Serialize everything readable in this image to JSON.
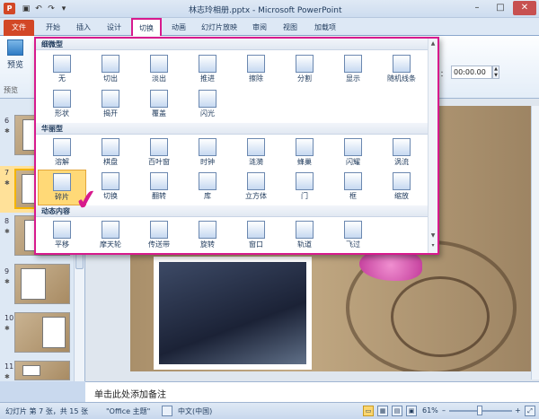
{
  "window": {
    "title": "林志玲相册.pptx - Microsoft PowerPoint",
    "app_icon": "P",
    "minimize_glyph": "–",
    "maximize_glyph": "□",
    "close_glyph": "✕"
  },
  "qat": {
    "save_icon": "▣",
    "undo_icon": "↶",
    "redo_icon": "↷",
    "menu_icon": "▾"
  },
  "tabs": {
    "file": "文件",
    "items": [
      "开始",
      "插入",
      "设计",
      "切换",
      "动画",
      "幻灯片放映",
      "审阅",
      "视图",
      "加载项"
    ],
    "active": "切换"
  },
  "ribbon": {
    "preview_label": "预览",
    "group_preview": "预览",
    "time_label": "：",
    "time_value": "00:00.00",
    "spin_up": "▲",
    "spin_down": "▼"
  },
  "gallery": {
    "sections": [
      {
        "title": "细微型",
        "items": [
          "无",
          "切出",
          "淡出",
          "推进",
          "擦除",
          "分割",
          "显示",
          "随机线条",
          "形状",
          "揭开",
          "覆盖",
          "闪光"
        ]
      },
      {
        "title": "华丽型",
        "items": [
          "溶解",
          "棋盘",
          "百叶窗",
          "时钟",
          "涟漪",
          "蜂巢",
          "闪耀",
          "涡流",
          "碎片",
          "切换",
          "翻转",
          "库",
          "立方体",
          "门",
          "框",
          "缩放"
        ]
      },
      {
        "title": "动态内容",
        "items": [
          "平移",
          "摩天轮",
          "传送带",
          "旋转",
          "窗口",
          "轨道",
          "飞过"
        ]
      }
    ],
    "selected": "碎片",
    "check_mark": "✔",
    "scroll_up": "▲",
    "scroll_down": "▼",
    "scroll_more": "▾"
  },
  "sidebar": {
    "slides": [
      {
        "num": "6",
        "star": "✱"
      },
      {
        "num": "7",
        "star": "✱"
      },
      {
        "num": "8",
        "star": "✱"
      },
      {
        "num": "9",
        "star": "✱"
      },
      {
        "num": "10",
        "star": "✱"
      },
      {
        "num": "11",
        "star": "✱"
      }
    ],
    "selected": "7"
  },
  "notes": {
    "placeholder": "单击此处添加备注"
  },
  "status": {
    "slide_info": "幻灯片 第 7 张，共 15 张",
    "theme": "\"Office 主题\"",
    "language": "中文(中国)",
    "zoom": "61%",
    "zoom_minus": "–",
    "zoom_plus": "+",
    "fit_icon": "⤢",
    "view_icons": [
      "▭",
      "▦",
      "▤",
      "▣"
    ]
  }
}
